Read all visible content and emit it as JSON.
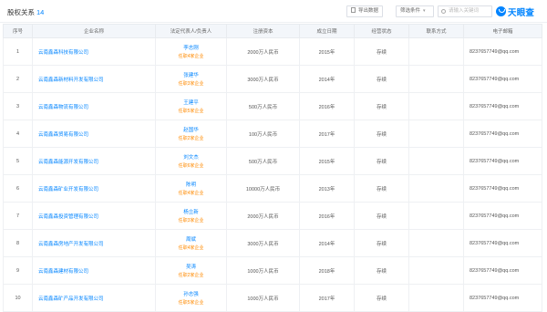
{
  "header": {
    "title": "股权关系",
    "count": "14",
    "export_label": "导出数据",
    "filter_label": "筛选条件",
    "search_placeholder": "请输入关键词",
    "logo_text": "天眼查"
  },
  "table": {
    "columns": [
      "序号",
      "企业名称",
      "法定代表人/负责人",
      "注册资本",
      "成立日期",
      "经营状态",
      "联系方式",
      "电子邮箱"
    ],
    "rows": [
      {
        "no": "1",
        "company": "云南鑫森科技有限公司",
        "rep": "李志刚",
        "tag": "任职4家企业",
        "capital": "2000万人民币",
        "date": "2015年",
        "status": "存续",
        "phone": "",
        "email": "8237657749@qq.com"
      },
      {
        "no": "2",
        "company": "云南鑫森新材料开发有限公司",
        "rep": "张建华",
        "tag": "任职3家企业",
        "capital": "3000万人民币",
        "date": "2014年",
        "status": "存续",
        "phone": "",
        "email": "8237657749@qq.com"
      },
      {
        "no": "3",
        "company": "云南鑫森物流有限公司",
        "rep": "王建平",
        "tag": "任职5家企业",
        "capital": "500万人民币",
        "date": "2016年",
        "status": "存续",
        "phone": "",
        "email": "8237657749@qq.com"
      },
      {
        "no": "4",
        "company": "云南鑫森贸易有限公司",
        "rep": "赵国华",
        "tag": "任职2家企业",
        "capital": "100万人民币",
        "date": "2017年",
        "status": "存续",
        "phone": "",
        "email": "8237657749@qq.com"
      },
      {
        "no": "5",
        "company": "云南鑫森能源开发有限公司",
        "rep": "刘文杰",
        "tag": "任职6家企业",
        "capital": "500万人民币",
        "date": "2015年",
        "status": "存续",
        "phone": "",
        "email": "8237657749@qq.com"
      },
      {
        "no": "6",
        "company": "云南鑫森矿业开发有限公司",
        "rep": "陈明",
        "tag": "任职4家企业",
        "capital": "10000万人民币",
        "date": "2013年",
        "status": "存续",
        "phone": "",
        "email": "8237657749@qq.com"
      },
      {
        "no": "7",
        "company": "云南鑫森投资管理有限公司",
        "rep": "杨立新",
        "tag": "任职3家企业",
        "capital": "2000万人民币",
        "date": "2016年",
        "status": "存续",
        "phone": "",
        "email": "8237657749@qq.com"
      },
      {
        "no": "8",
        "company": "云南鑫森房地产开发有限公司",
        "rep": "周斌",
        "tag": "任职4家企业",
        "capital": "3000万人民币",
        "date": "2014年",
        "status": "存续",
        "phone": "",
        "email": "8237657749@qq.com"
      },
      {
        "no": "9",
        "company": "云南鑫森建材有限公司",
        "rep": "吴涛",
        "tag": "任职2家企业",
        "capital": "1000万人民币",
        "date": "2018年",
        "status": "存续",
        "phone": "",
        "email": "8237657749@qq.com"
      },
      {
        "no": "10",
        "company": "云南鑫森矿产品开发有限公司",
        "rep": "孙志强",
        "tag": "任职5家企业",
        "capital": "1000万人民币",
        "date": "2017年",
        "status": "存续",
        "phone": "",
        "email": "8237657749@qq.com"
      }
    ]
  }
}
